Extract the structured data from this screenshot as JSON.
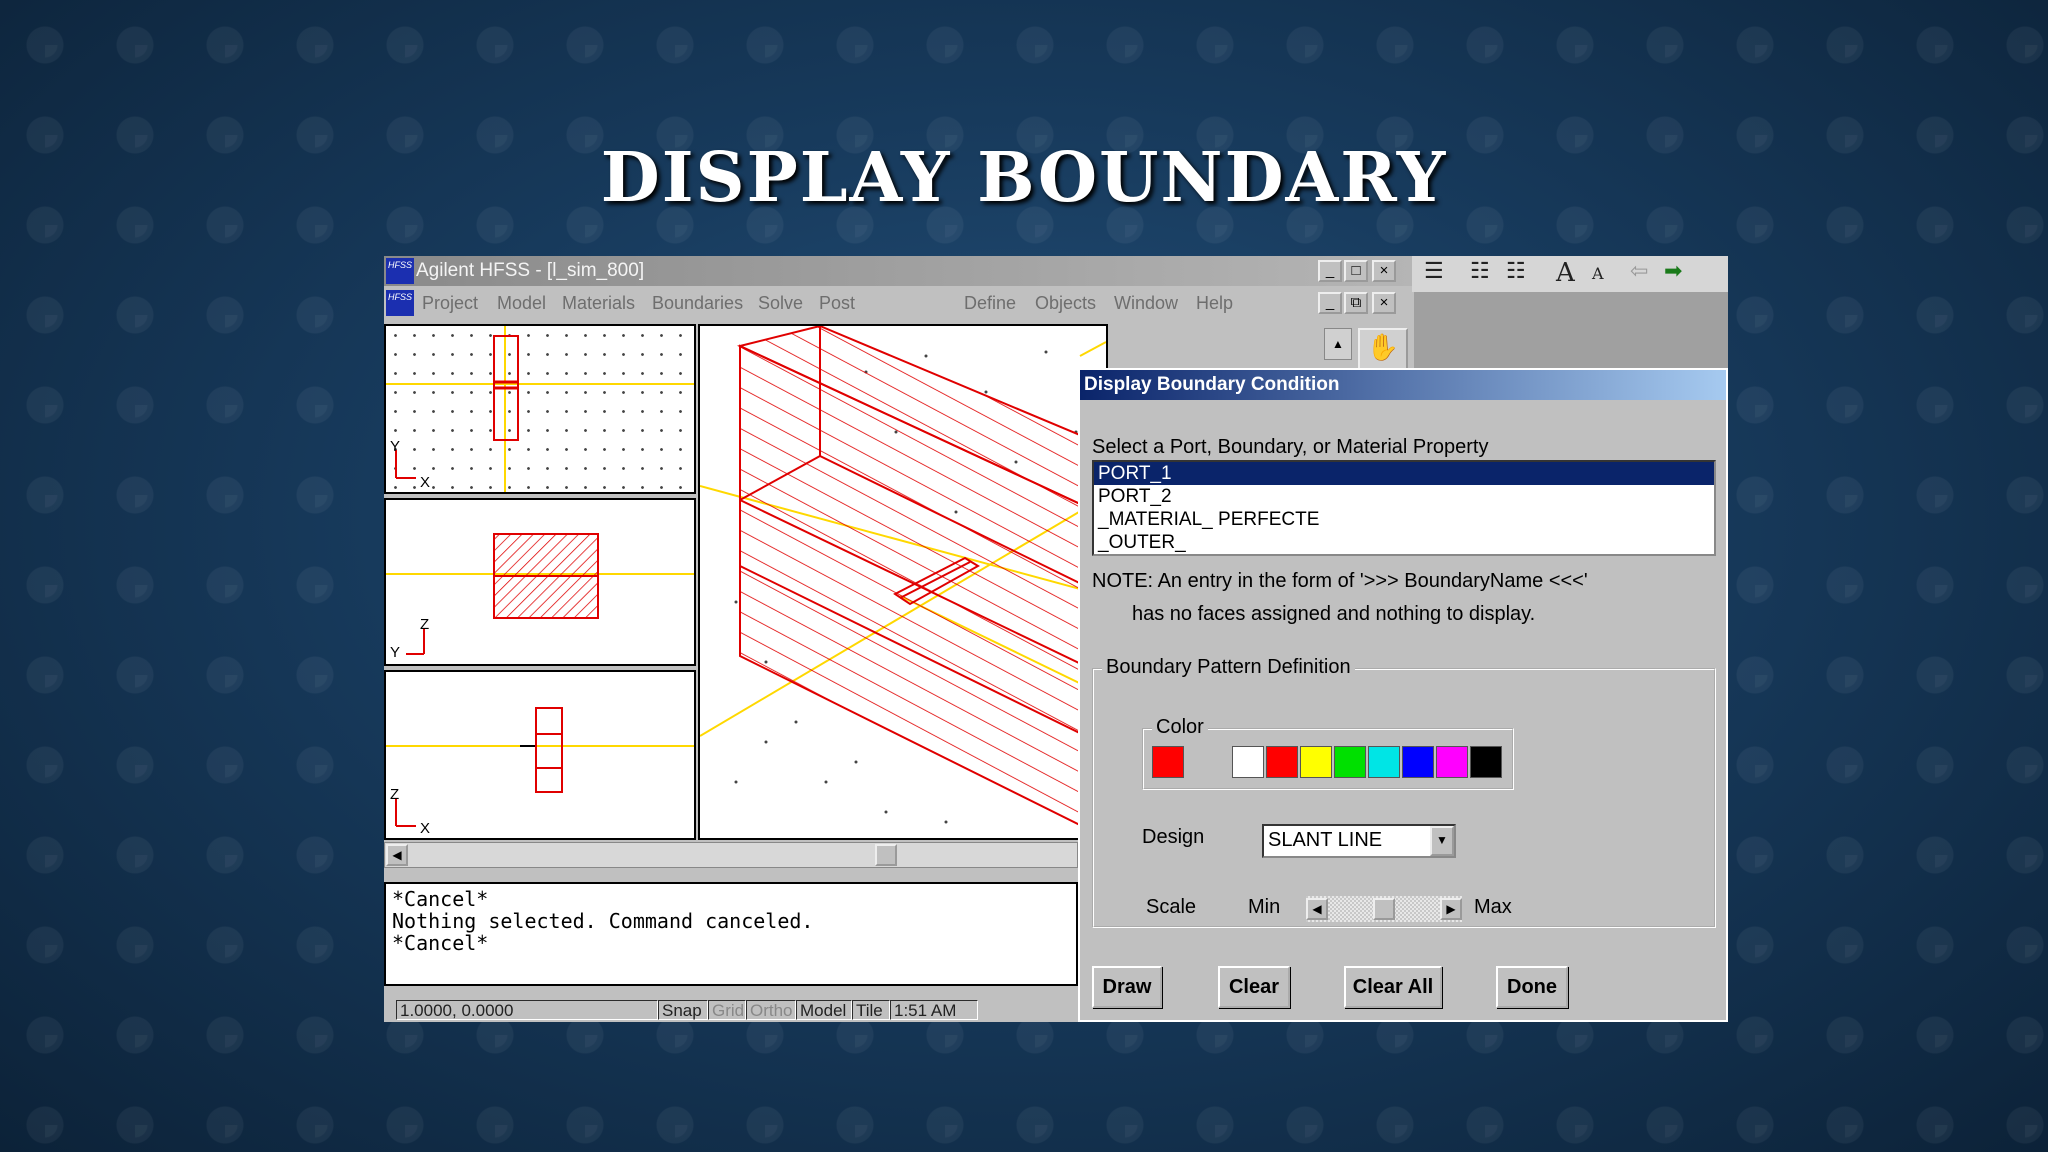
{
  "slide": {
    "title": "DISPLAY BOUNDARY"
  },
  "window": {
    "app_icon_text": "HFSS",
    "title": "Agilent HFSS - [l_sim_800]",
    "controls": {
      "minimize": "_",
      "maximize": "□",
      "close": "×",
      "restore": "⧉"
    }
  },
  "menu": {
    "items": [
      "Project",
      "Model",
      "Materials",
      "Boundaries",
      "Solve",
      "Post",
      "Define",
      "Objects",
      "Window",
      "Help"
    ]
  },
  "toolbar": {
    "icons": [
      "align-justify-icon",
      "numbered-list-icon",
      "bullet-list-icon",
      "font-grow-icon",
      "font-shrink-icon",
      "arrow-left-icon",
      "arrow-right-icon"
    ],
    "font_grow": "A",
    "font_shrink": "A"
  },
  "views": {
    "top": {
      "axis_v": "Y",
      "axis_h": "X"
    },
    "side": {
      "axis_v": "Z",
      "axis_h": "Y"
    },
    "front": {
      "axis_v": "Z",
      "axis_h": "X"
    }
  },
  "console": {
    "lines": [
      "*Cancel*",
      "Nothing selected.  Command canceled.",
      "*Cancel*"
    ]
  },
  "status": {
    "coords": "1.0000,   0.0000",
    "snap": "Snap",
    "grid": "Grid",
    "ortho": "Ortho",
    "model": "Model",
    "tile": "Tile",
    "time": "1:51 AM"
  },
  "dialog": {
    "title": "Display Boundary Condition",
    "prompt": "Select a Port, Boundary, or Material Property",
    "items": [
      "PORT_1",
      "PORT_2",
      "_MATERIAL_ PERFECTE",
      "_OUTER_"
    ],
    "selected_index": 0,
    "note_line1": "NOTE: An entry in the form of  '>>> BoundaryName <<<'",
    "note_line2": "has no faces assigned and nothing to display.",
    "pattern_group_label": "Boundary Pattern Definition",
    "color_group_label": "Color",
    "current_color": "#ff0000",
    "palette": [
      "#ffffff",
      "#ff0000",
      "#ffff00",
      "#00e000",
      "#00e5e5",
      "#0000ff",
      "#ff00ff",
      "#000000"
    ],
    "design_label": "Design",
    "design_value": "SLANT LINE",
    "scale_label": "Scale",
    "scale_min": "Min",
    "scale_max": "Max",
    "scale_value": 0.5,
    "buttons": {
      "draw": "Draw",
      "clear": "Clear",
      "clear_all": "Clear All",
      "done": "Done"
    }
  }
}
